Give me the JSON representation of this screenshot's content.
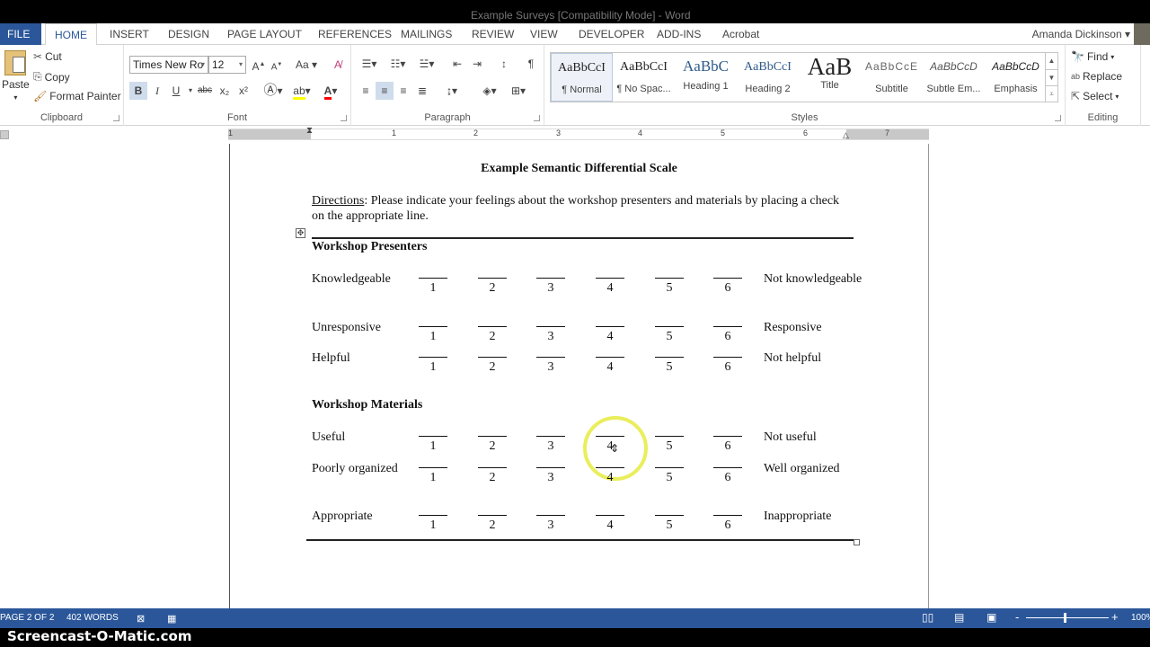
{
  "window": {
    "title": "Example Surveys [Compatibility Mode] - Word"
  },
  "tabs": [
    {
      "label": "FILE"
    },
    {
      "label": "HOME"
    },
    {
      "label": "INSERT"
    },
    {
      "label": "DESIGN"
    },
    {
      "label": "PAGE LAYOUT"
    },
    {
      "label": "REFERENCES"
    },
    {
      "label": "MAILINGS"
    },
    {
      "label": "REVIEW"
    },
    {
      "label": "VIEW"
    },
    {
      "label": "DEVELOPER"
    },
    {
      "label": "ADD-INS"
    },
    {
      "label": "Acrobat"
    }
  ],
  "active_tab": "HOME",
  "user": {
    "name": "Amanda Dickinson"
  },
  "ribbon": {
    "clipboard": {
      "label": "Clipboard",
      "paste": "Paste",
      "cut": "Cut",
      "copy": "Copy",
      "format_painter": "Format Painter"
    },
    "font": {
      "label": "Font",
      "font_name": "Times New Ro",
      "font_size": "12",
      "bold": "B",
      "italic": "I",
      "underline": "U",
      "strike": "abc",
      "subscript": "x₂",
      "superscript": "x²",
      "case": "Aa",
      "highlight_color": "#ffff00",
      "font_color": "#ff0000"
    },
    "paragraph": {
      "label": "Paragraph"
    },
    "styles": {
      "label": "Styles",
      "items": [
        {
          "sample": "AaBbCcI",
          "name": "¶ Normal",
          "selected": true
        },
        {
          "sample": "AaBbCcI",
          "name": "¶ No Spac..."
        },
        {
          "sample": "AaBbC",
          "name": "Heading 1"
        },
        {
          "sample": "AaBbCcI",
          "name": "Heading 2"
        },
        {
          "sample": "AaB",
          "name": "Title"
        },
        {
          "sample": "AaBbCcE",
          "name": "Subtitle"
        },
        {
          "sample": "AaBbCcD",
          "name": "Subtle Em..."
        },
        {
          "sample": "AaBbCcD",
          "name": "Emphasis"
        }
      ]
    },
    "editing": {
      "label": "Editing",
      "find": "Find",
      "replace": "Replace",
      "select": "Select"
    }
  },
  "ruler": {
    "numbers": [
      "1",
      "1",
      "2",
      "3",
      "4",
      "5",
      "6",
      "7"
    ]
  },
  "document": {
    "title": "Example Semantic Differential Scale",
    "directions_label": "Directions",
    "directions_text": ":  Please indicate your feelings about the workshop presenters and materials by placing a check on the appropriate line.",
    "scale": [
      "1",
      "2",
      "3",
      "4",
      "5",
      "6"
    ],
    "sections": [
      {
        "heading": "Workshop Presenters",
        "rows": [
          {
            "left": "Knowledgeable",
            "right": "Not knowledgeable"
          },
          {
            "left": "Unresponsive",
            "right": "Responsive"
          },
          {
            "left": "Helpful",
            "right": "Not helpful"
          }
        ]
      },
      {
        "heading": "Workshop Materials",
        "rows": [
          {
            "left": "Useful",
            "right": "Not useful"
          },
          {
            "left": "Poorly organized",
            "right": "Well organized"
          },
          {
            "left": "Appropriate",
            "right": "Inappropriate"
          }
        ]
      }
    ]
  },
  "status": {
    "page": "PAGE 2 OF 2",
    "words": "402 WORDS",
    "zoom": "100%",
    "zoom_minus": "-",
    "zoom_plus": "+"
  },
  "watermark": "Screencast-O-Matic.com"
}
